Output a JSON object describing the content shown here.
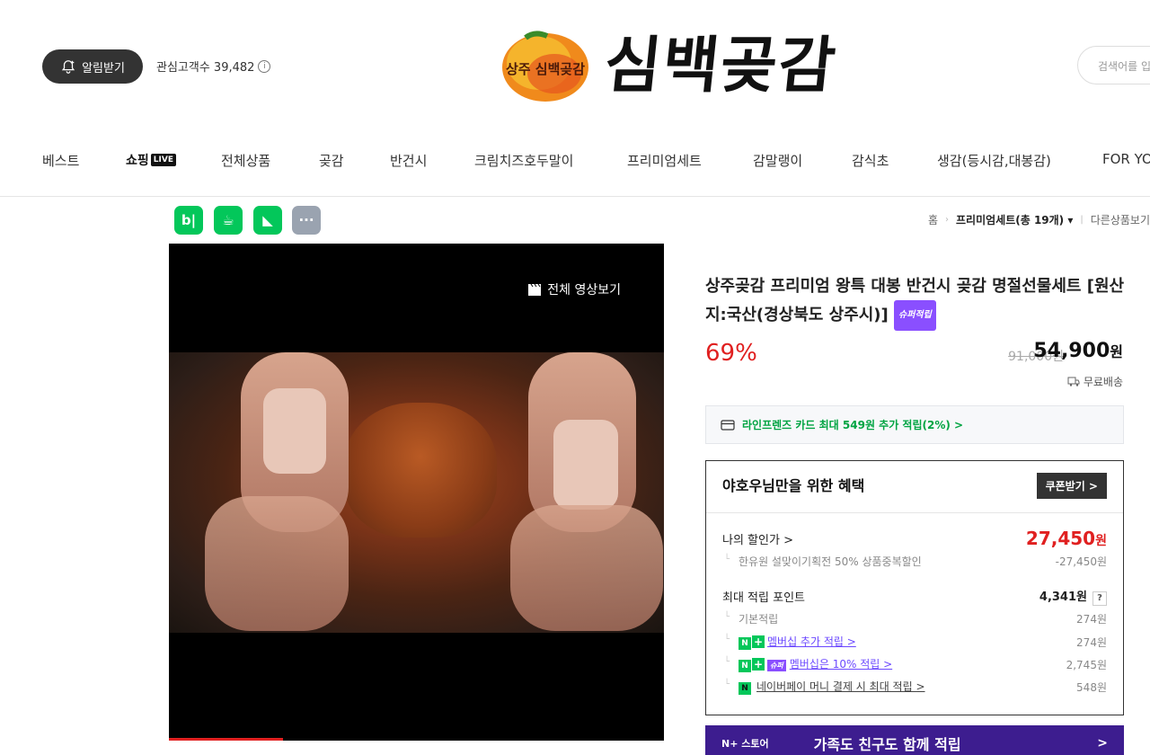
{
  "header": {
    "notify_label": "알림받기",
    "interest_label": "관심고객수 39,482",
    "logo_text": "심백곶감",
    "logo_emblem_text": "상주 심백곶감",
    "search_placeholder": "검색어를 입력하세요"
  },
  "nav": [
    {
      "label": "베스트"
    },
    {
      "label": "쇼핑",
      "badge": "LIVE"
    },
    {
      "label": "전체상품"
    },
    {
      "label": "곶감"
    },
    {
      "label": "반건시"
    },
    {
      "label": "크림치즈호두말이"
    },
    {
      "label": "프리미엄세트"
    },
    {
      "label": "감말랭이"
    },
    {
      "label": "감식초"
    },
    {
      "label": "생감(등시감,대봉감)"
    },
    {
      "label": "FOR YOU"
    }
  ],
  "share_icons": [
    "blog-icon",
    "cafe-icon",
    "keep-icon",
    "more-icon"
  ],
  "share_glyphs": [
    "b|",
    "☕",
    "◣",
    "···"
  ],
  "breadcrumb": {
    "home": "홈",
    "current": "프리미엄세트(총 19개)",
    "other": "다른상품보기"
  },
  "video": {
    "label": "전체 영상보기"
  },
  "product": {
    "title": "상주곶감 프리미엄 왕특 대봉 반건시 곶감 명절선물세트 [원산지:국산(경상북도 상주시)]",
    "badge": "슈퍼적립",
    "discount": "69%",
    "original_price": "91,000원",
    "price": "54,900",
    "price_unit": "원",
    "shipping": "무료배송"
  },
  "card_promo": "라인프렌즈 카드 최대 549원 추가 적립(2%) >",
  "benefit": {
    "title": "야호우님만을 위한 혜택",
    "coupon_label": "쿠폰받기 >",
    "my_price_label": "나의 할인가 >",
    "my_price": "27,450",
    "my_price_unit": "원",
    "discount_detail_label": "한유원 설맞이기획전 50% 상품중복할인",
    "discount_detail_value": "-27,450원",
    "max_points_label": "최대 적립 포인트",
    "max_points_value": "4,341원",
    "q_label": "?",
    "basic_label": "기본적립",
    "basic_value": "274원",
    "membership_label": "멤버십 추가 적립 >",
    "membership_value": "274원",
    "super_label": "멤버십은 10% 적립 >",
    "super_badge": "슈퍼",
    "super_value": "2,745원",
    "npay_label": "네이버페이 머니 결제 시 최대 적립 >",
    "npay_value": "548원"
  },
  "store_banner": {
    "brand": "N+ 스토어",
    "text": "가족도 친구도 함께 적립",
    "arrow": ">"
  },
  "colors": {
    "accent_red": "#e02020",
    "naver_green": "#03c75a",
    "purple": "#6b48ff",
    "banner_purple": "#3d1d8f"
  }
}
